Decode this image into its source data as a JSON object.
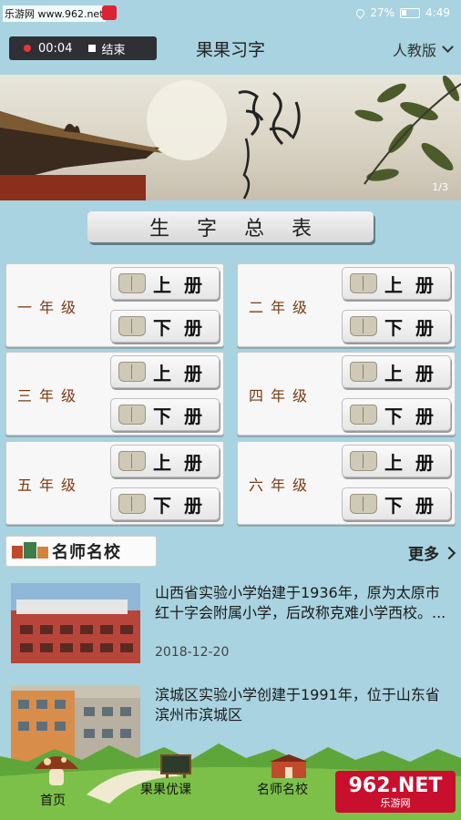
{
  "statusbar": {
    "watermark": "乐游网 www.962.net",
    "battery": "27%",
    "time": "4:49"
  },
  "header": {
    "rec_time": "00:04",
    "stop_label": "结束",
    "title": "果果习字",
    "edition": "人教版"
  },
  "banner": {
    "page_indicator": "1/3"
  },
  "summary_button": "生字总表",
  "grades": [
    {
      "name": "一年级",
      "up": "上册",
      "down": "下册"
    },
    {
      "name": "二年级",
      "up": "上册",
      "down": "下册"
    },
    {
      "name": "三年级",
      "up": "上册",
      "down": "下册"
    },
    {
      "name": "四年级",
      "up": "上册",
      "down": "下册"
    },
    {
      "name": "五年级",
      "up": "上册",
      "down": "下册"
    },
    {
      "name": "六年级",
      "up": "上册",
      "down": "下册"
    }
  ],
  "famous": {
    "tab_label": "名师名校",
    "more_label": "更多"
  },
  "news": [
    {
      "text": "山西省实验小学始建于1936年，原为太原市红十字会附属小学，后改称克难小学西校。...",
      "date": "2018-12-20"
    },
    {
      "text": "滨城区实验小学创建于1991年，位于山东省滨州市滨城区",
      "date": ""
    }
  ],
  "tabbar": {
    "home": "首页",
    "courses": "果果优课",
    "schools": "名师名校"
  },
  "watermark_bottom": {
    "big": "962.NET",
    "small": "乐游网"
  }
}
